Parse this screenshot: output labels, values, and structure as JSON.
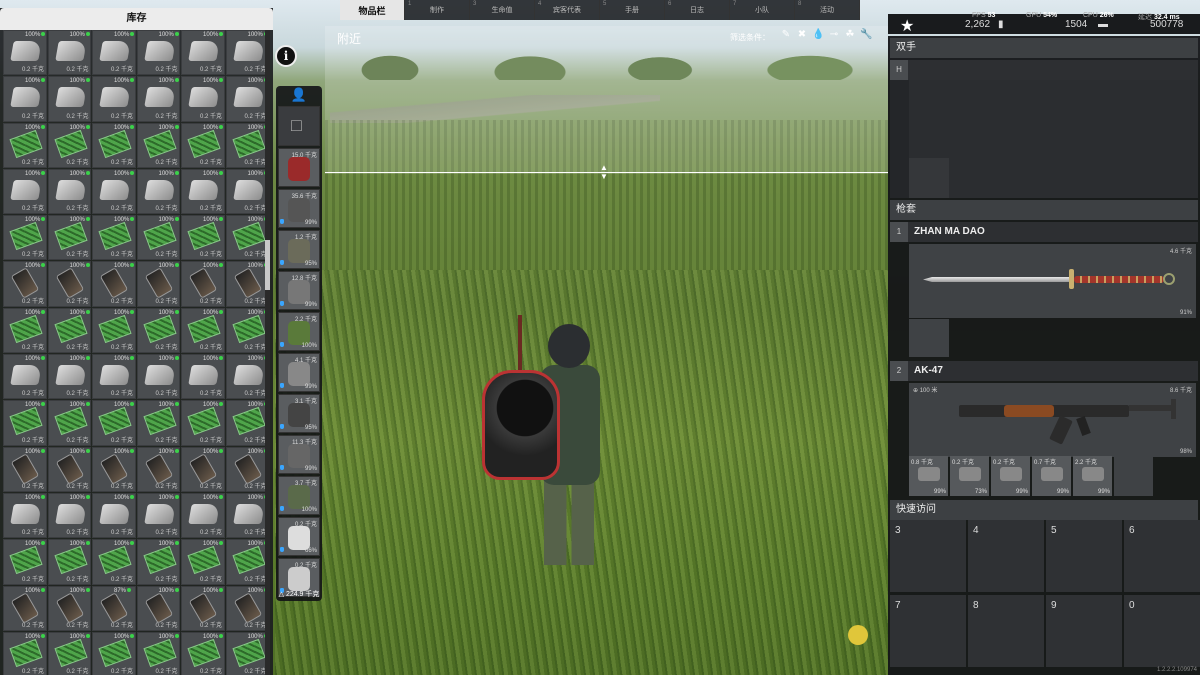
{
  "top_tabs": [
    {
      "num": "",
      "label": "物品栏",
      "active": true
    },
    {
      "num": "1",
      "label": "制作",
      "active": false
    },
    {
      "num": "3",
      "label": "生命值",
      "active": false
    },
    {
      "num": "4",
      "label": "宾客代表",
      "active": false
    },
    {
      "num": "5",
      "label": "手册",
      "active": false
    },
    {
      "num": "6",
      "label": "日志",
      "active": false
    },
    {
      "num": "7",
      "label": "小队",
      "active": false
    },
    {
      "num": "8",
      "label": "活动",
      "active": false
    }
  ],
  "inventory": {
    "title": "库存",
    "item_condition": "100%",
    "item_weight": "0.2 千克",
    "item_types": [
      "pot",
      "pot",
      "board",
      "pot",
      "board",
      "phone",
      "board",
      "pot",
      "board",
      "phone",
      "pot",
      "board",
      "phone",
      "board"
    ],
    "special_condition": "87%"
  },
  "info_button": {
    "label": "i"
  },
  "equipment": {
    "top_icon": "person-icon",
    "slots": [
      {
        "weight": "",
        "pct": "",
        "color": "#2e3033"
      },
      {
        "weight": "15.0 千克",
        "pct": "",
        "color": "#9a2a2a"
      },
      {
        "weight": "35.6 千克",
        "pct": "99%",
        "color": "#555"
      },
      {
        "weight": "1.2 千克",
        "pct": "95%",
        "color": "#6b6b5a"
      },
      {
        "weight": "12.8 千克",
        "pct": "99%",
        "color": "#777"
      },
      {
        "weight": "2.2 千克",
        "pct": "100%",
        "color": "#5a7a3a"
      },
      {
        "weight": "4.1 千克",
        "pct": "99%",
        "color": "#888"
      },
      {
        "weight": "3.1 千克",
        "pct": "95%",
        "color": "#444"
      },
      {
        "weight": "11.3 千克",
        "pct": "99%",
        "color": "#666"
      },
      {
        "weight": "3.7 千克",
        "pct": "100%",
        "color": "#5a6a4a"
      },
      {
        "weight": "0.2 千克",
        "pct": "66%",
        "color": "#ddd"
      },
      {
        "weight": "0.2 千克",
        "pct": "",
        "color": "#ccc"
      }
    ],
    "total_weight": "224.9 千克"
  },
  "nearby": {
    "title": "附近",
    "filter_label": "筛选条件：",
    "filter_icons": [
      "shirt-icon",
      "crossed-tools-icon",
      "drop-icon",
      "gun-icon",
      "grass-icon",
      "wrench-icon"
    ]
  },
  "stats": {
    "fps_label": "FPS",
    "fps": "53",
    "gpu_label": "GPU",
    "gpu": "54%",
    "cpu_label": "CPU",
    "cpu": "26%",
    "delay_label": "延迟",
    "delay": "32.4 ms",
    "money": "2,262",
    "ammo": "1504",
    "cash": "500778"
  },
  "right_panel": {
    "hands_title": "双手",
    "hands_key": "H",
    "holster_title": "枪套",
    "weapons": [
      {
        "index": "1",
        "name": "ZHAN MA DAO",
        "weight": "4.6 千克",
        "condition": "91%",
        "range": ""
      },
      {
        "index": "2",
        "name": "AK-47",
        "weight": "8.6 千克",
        "condition": "98%",
        "range": "100 米"
      }
    ],
    "attachments": [
      {
        "weight": "0.8 千克",
        "pct": "99%"
      },
      {
        "weight": "0.2 千克",
        "pct": "73%"
      },
      {
        "weight": "0.2 千克",
        "pct": "99%"
      },
      {
        "weight": "0.7 千克",
        "pct": "99%"
      },
      {
        "weight": "2.2 千克",
        "pct": "99%"
      }
    ],
    "quick_access_title": "快速访问",
    "quick_slots": [
      "3",
      "4",
      "5",
      "6",
      "7",
      "8",
      "9",
      "0"
    ]
  },
  "version": "1.2.2.2.109974"
}
